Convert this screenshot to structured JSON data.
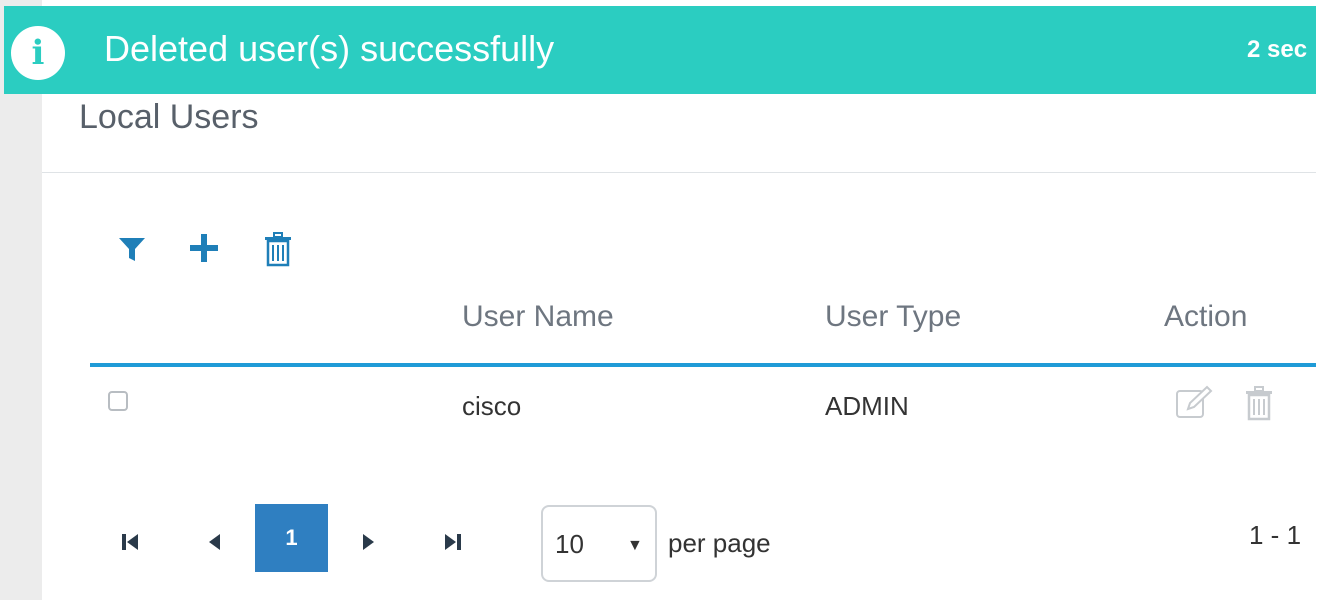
{
  "toast": {
    "icon": "info-icon",
    "message": "Deleted user(s) successfully",
    "timer": "2 sec",
    "color": "#2bcdc1"
  },
  "page": {
    "title": "Local Users"
  },
  "toolbar": {
    "filter_icon": "filter-icon",
    "add_icon": "plus-icon",
    "delete_icon": "trash-icon",
    "accent": "#1f7fb8"
  },
  "table": {
    "columns": [
      "User Name",
      "User Type",
      "Action"
    ],
    "rows": [
      {
        "checked": false,
        "user_name": "cisco",
        "user_type": "ADMIN",
        "actions": [
          "edit-icon",
          "trash-icon"
        ]
      }
    ],
    "header_rule_color": "#1f9bd7"
  },
  "pagination": {
    "current_page": "1",
    "per_page": "10",
    "per_page_label": "per page",
    "range": "1 - 1",
    "active_color": "#2f7fc1"
  }
}
